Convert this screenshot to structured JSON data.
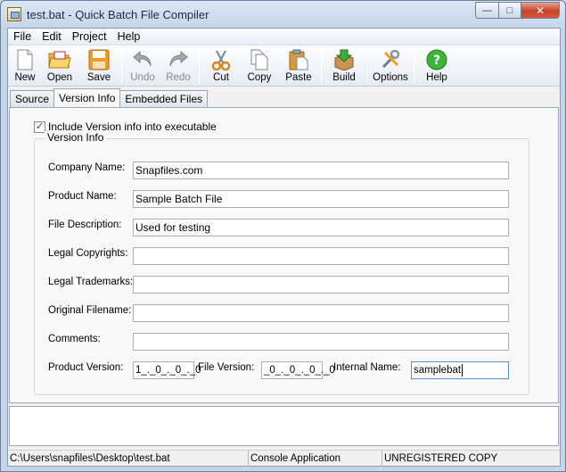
{
  "window": {
    "title": "test.bat - Quick Batch File Compiler",
    "min_glyph": "—",
    "max_glyph": "□",
    "close_glyph": "✕"
  },
  "menu": [
    "File",
    "Edit",
    "Project",
    "Help"
  ],
  "toolbar": {
    "new": "New",
    "open": "Open",
    "save": "Save",
    "undo": "Undo",
    "redo": "Redo",
    "cut": "Cut",
    "copy": "Copy",
    "paste": "Paste",
    "build": "Build",
    "options": "Options",
    "help": "Help"
  },
  "tabs": {
    "source": "Source",
    "version_info": "Version Info",
    "embedded_files": "Embedded Files"
  },
  "version_panel": {
    "include_label": "Include Version info into executable",
    "include_checked": "✓",
    "group_title": "Version Info",
    "fields": {
      "company_label": "Company Name:",
      "company_value": "Snapfiles.com",
      "product_label": "Product Name:",
      "product_value": "Sample Batch File",
      "description_label": "File Description:",
      "description_value": "Used for testing",
      "copyrights_label": "Legal Copyrights:",
      "copyrights_value": "",
      "trademarks_label": "Legal Trademarks:",
      "trademarks_value": "",
      "filename_label": "Original Filename:",
      "filename_value": "",
      "comments_label": "Comments:",
      "comments_value": ""
    },
    "product_version_label": "Product Version:",
    "product_version_value": "1_._0_._0_._0",
    "file_version_label": "File Version:",
    "file_version_value": "_0_._0_._0_._0",
    "internal_name_label": "Internal Name:",
    "internal_name_value": "samplebat"
  },
  "status": {
    "path": "C:\\Users\\snapfiles\\Desktop\\test.bat",
    "type": "Console Application",
    "license": "UNREGISTERED COPY"
  }
}
